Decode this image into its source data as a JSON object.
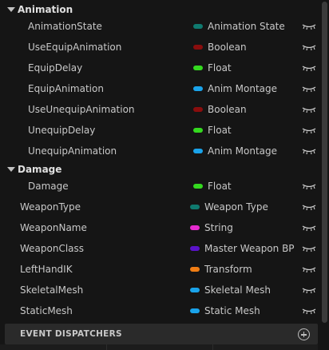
{
  "categories": {
    "animation": "Animation",
    "damage": "Damage"
  },
  "animation_vars": [
    {
      "name": "AnimationState",
      "type": "Animation State",
      "color": "#0f7a6f"
    },
    {
      "name": "UseEquipAnimation",
      "type": "Boolean",
      "color": "#8a0d0d"
    },
    {
      "name": "EquipDelay",
      "type": "Float",
      "color": "#34d91f"
    },
    {
      "name": "EquipAnimation",
      "type": "Anim Montage",
      "color": "#1aa3ea"
    },
    {
      "name": "UseUnequipAnimation",
      "type": "Boolean",
      "color": "#8a0d0d"
    },
    {
      "name": "UnequipDelay",
      "type": "Float",
      "color": "#34d91f"
    },
    {
      "name": "UnequipAnimation",
      "type": "Anim Montage",
      "color": "#1aa3ea"
    }
  ],
  "damage_vars": [
    {
      "name": "Damage",
      "type": "Float",
      "color": "#34d91f"
    }
  ],
  "root_vars": [
    {
      "name": "WeaponType",
      "type": "Weapon Type",
      "color": "#0f7a6f"
    },
    {
      "name": "WeaponName",
      "type": "String",
      "color": "#e62bcf"
    },
    {
      "name": "WeaponClass",
      "type": "Master Weapon BP",
      "color": "#5a13c9"
    },
    {
      "name": "LeftHandIK",
      "type": "Transform",
      "color": "#f07d14"
    },
    {
      "name": "SkeletalMesh",
      "type": "Skeletal Mesh",
      "color": "#1aa3ea"
    },
    {
      "name": "StaticMesh",
      "type": "Static Mesh",
      "color": "#1aa3ea"
    }
  ],
  "event_dispatchers": {
    "title": "EVENT DISPATCHERS"
  }
}
